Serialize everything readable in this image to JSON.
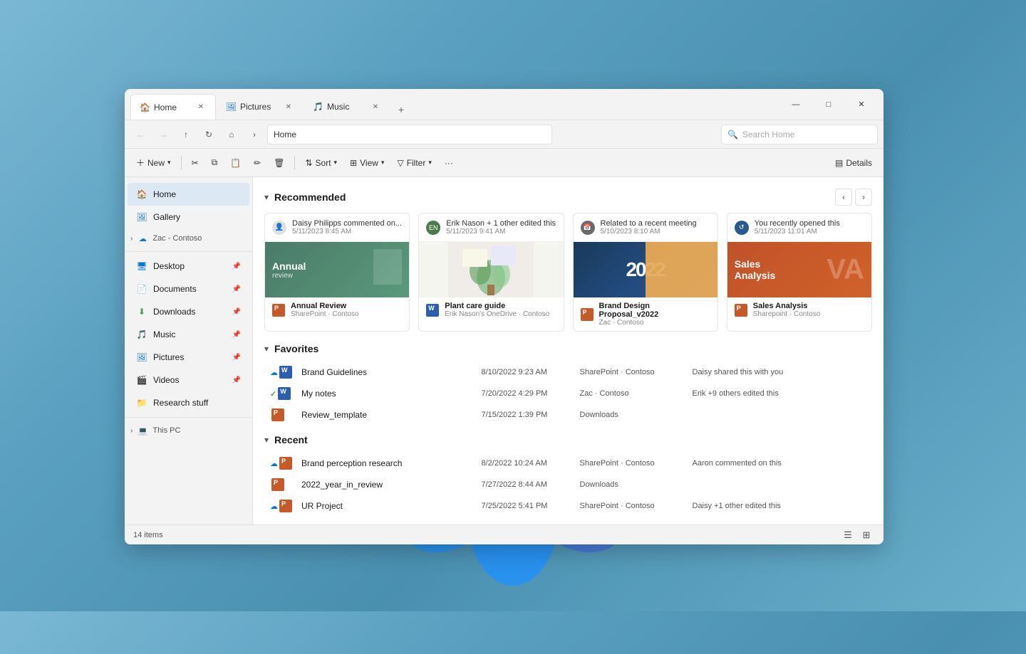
{
  "window": {
    "tabs": [
      {
        "label": "Home",
        "icon": "home",
        "active": true
      },
      {
        "label": "Pictures",
        "icon": "pictures",
        "active": false
      },
      {
        "label": "Music",
        "icon": "music",
        "active": false
      }
    ],
    "new_tab_label": "+",
    "controls": {
      "minimize": "—",
      "maximize": "□",
      "close": "✕"
    }
  },
  "address_bar": {
    "back": "←",
    "forward": "→",
    "up": "↑",
    "refresh": "↻",
    "home": "⌂",
    "chevron": "›",
    "path": "Home",
    "search_placeholder": "Search Home"
  },
  "toolbar": {
    "new_label": "New",
    "cut_label": "✂",
    "copy_label": "⧉",
    "paste_label": "📋",
    "rename_label": "✏",
    "delete_label": "🗑",
    "sort_label": "Sort",
    "view_label": "View",
    "filter_label": "Filter",
    "more_label": "···",
    "details_label": "Details"
  },
  "sidebar": {
    "items": [
      {
        "label": "Home",
        "icon": "home",
        "active": true,
        "pinned": false
      },
      {
        "label": "Gallery",
        "icon": "gallery",
        "pinned": false
      },
      {
        "label": "Zac - Contoso",
        "icon": "onedrive",
        "pinned": false,
        "expandable": true
      },
      {
        "label": "Desktop",
        "icon": "desktop",
        "pinned": true
      },
      {
        "label": "Documents",
        "icon": "documents",
        "pinned": true
      },
      {
        "label": "Downloads",
        "icon": "downloads",
        "pinned": true
      },
      {
        "label": "Music",
        "icon": "music",
        "pinned": true
      },
      {
        "label": "Pictures",
        "icon": "pictures",
        "pinned": true
      },
      {
        "label": "Videos",
        "icon": "videos",
        "pinned": true
      },
      {
        "label": "Research stuff",
        "icon": "folder",
        "pinned": false
      },
      {
        "label": "This PC",
        "icon": "pc",
        "expandable": true
      }
    ]
  },
  "recommended": {
    "title": "Recommended",
    "chevron": "▾",
    "nav_prev": "‹",
    "nav_next": "›",
    "cards": [
      {
        "user": "Daisy Philipps commented on...",
        "time": "5/11/2023 8:45 AM",
        "preview_type": "annual",
        "preview_text": "Annual review",
        "name": "Annual Review",
        "location": "SharePoint · Contoso",
        "file_type": "ppt"
      },
      {
        "user": "Erik Nason + 1 other edited this",
        "time": "5/11/2023 9:41 AM",
        "preview_type": "plant",
        "name": "Plant care guide",
        "location": "Erik Nason's OneDrive · Contoso",
        "file_type": "word"
      },
      {
        "user": "Related to a recent meeting",
        "time": "5/10/2023 8:10 AM",
        "preview_type": "brand",
        "preview_text": "2022",
        "name": "Brand Design Proposal_v2022",
        "location": "Zac · Contoso",
        "file_type": "ppt"
      },
      {
        "user": "You recently opened this",
        "time": "5/11/2023 11:01 AM",
        "preview_type": "sales",
        "preview_text": "Sales Analysis",
        "name": "Sales Analysis",
        "location": "Sharepoint · Contoso",
        "file_type": "ppt"
      }
    ]
  },
  "favorites": {
    "title": "Favorites",
    "chevron": "▾",
    "items": [
      {
        "cloud": "sync",
        "file_type": "word",
        "name": "Brand Guidelines",
        "date": "8/10/2022 9:23 AM",
        "location": "SharePoint · Contoso",
        "activity": "Daisy shared this with you"
      },
      {
        "cloud": "ok",
        "file_type": "word",
        "name": "My notes",
        "date": "7/20/2022 4:29 PM",
        "location": "Zac · Contoso",
        "activity": "Erik +9 others edited this"
      },
      {
        "cloud": "",
        "file_type": "ppt",
        "name": "Review_template",
        "date": "7/15/2022 1:39 PM",
        "location": "Downloads",
        "activity": ""
      }
    ]
  },
  "recent": {
    "title": "Recent",
    "chevron": "▾",
    "items": [
      {
        "cloud": "sync",
        "file_type": "ppt",
        "name": "Brand perception research",
        "date": "8/2/2022 10:24 AM",
        "location": "SharePoint · Contoso",
        "activity": "Aaron commented on this"
      },
      {
        "cloud": "",
        "file_type": "ppt",
        "name": "2022_year_in_review",
        "date": "7/27/2022 8:44 AM",
        "location": "Downloads",
        "activity": ""
      },
      {
        "cloud": "sync",
        "file_type": "ppt",
        "name": "UR Project",
        "date": "7/25/2022 5:41 PM",
        "location": "SharePoint · Contoso",
        "activity": "Daisy +1 other edited this"
      }
    ]
  },
  "status_bar": {
    "count": "14 items"
  }
}
